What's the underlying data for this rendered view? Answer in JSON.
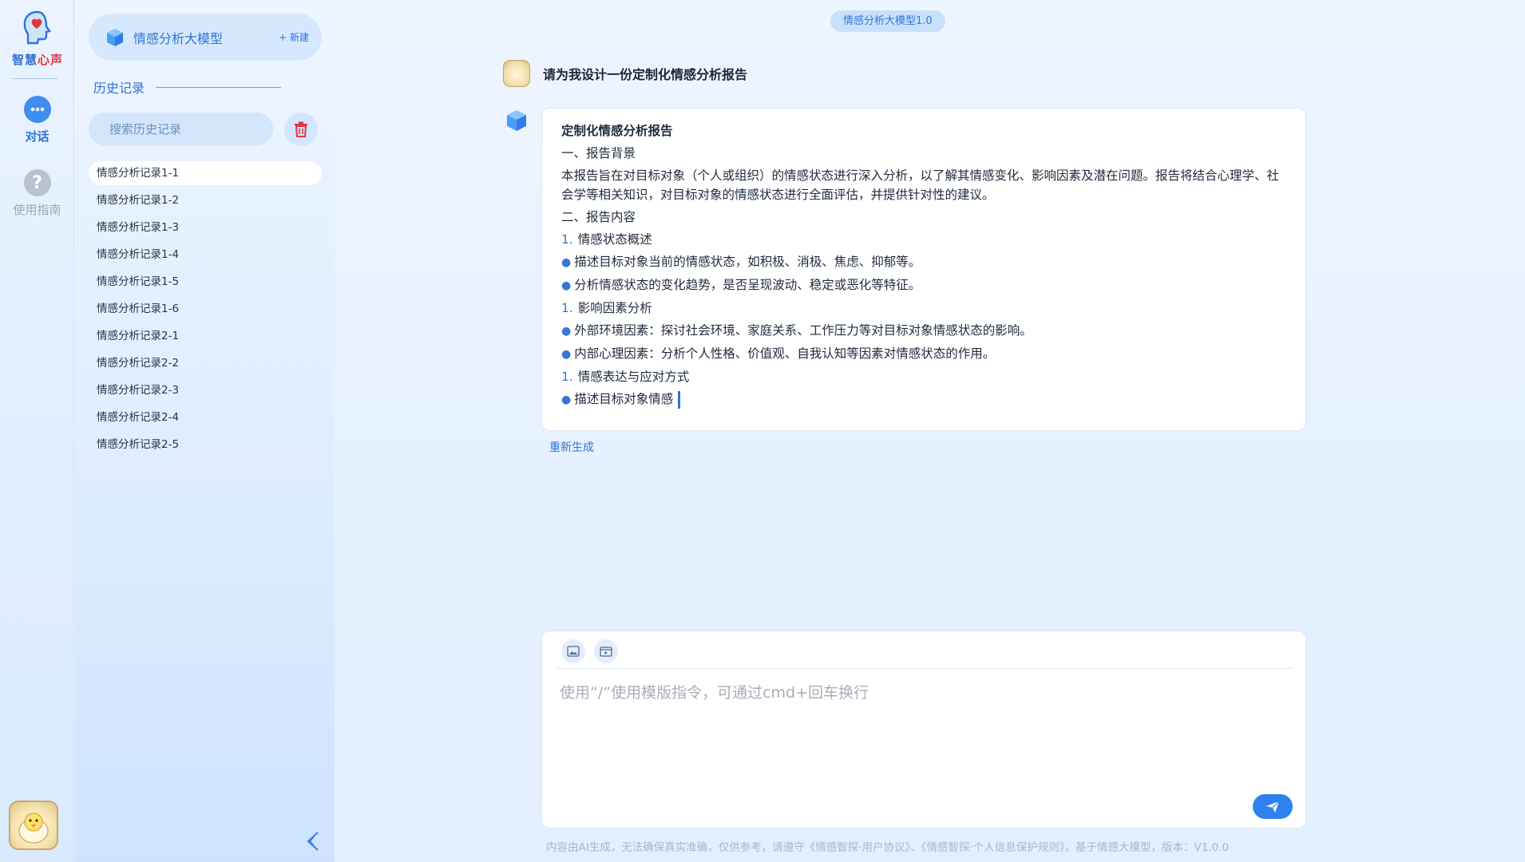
{
  "brand": {
    "name_part1": "智慧",
    "name_part2": "心声"
  },
  "rail": {
    "chat_label": "对话",
    "guide_label": "使用指南",
    "guide_glyph": "?"
  },
  "history_panel": {
    "model_name": "情感分析大模型",
    "new_label": "+ 新建",
    "title": "历史记录",
    "search_placeholder": "搜索历史记录",
    "items": [
      "情感分析记录1-1",
      "情感分析记录1-2",
      "情感分析记录1-3",
      "情感分析记录1-4",
      "情感分析记录1-5",
      "情感分析记录1-6",
      "情感分析记录2-1",
      "情感分析记录2-2",
      "情感分析记录2-3",
      "情感分析记录2-4",
      "情感分析记录2-5"
    ],
    "active_index": 0
  },
  "main": {
    "model_tag": "情感分析大模型1.0",
    "user_message": "请为我设计一份定制化情感分析报告",
    "response": {
      "title": "定制化情感分析报告",
      "section1": "一、报告背景",
      "background": "本报告旨在对目标对象（个人或组织）的情感状态进行深入分析，以了解其情感变化、影响因素及潜在问题。报告将结合心理学、社会学等相关知识，对目标对象的情感状态进行全面评估，并提供针对性的建议。",
      "section2": "二、报告内容",
      "item1_num": "1.",
      "item1": "情感状态概述",
      "item1_b1": "描述目标对象当前的情感状态，如积极、消极、焦虑、抑郁等。",
      "item1_b2": "分析情感状态的变化趋势，是否呈现波动、稳定或恶化等特征。",
      "item2_num": "1.",
      "item2": "影响因素分析",
      "item2_b1": "外部环境因素：探讨社会环境、家庭关系、工作压力等对目标对象情感状态的影响。",
      "item2_b2": "内部心理因素：分析个人性格、价值观、自我认知等因素对情感状态的作用。",
      "item3_num": "1.",
      "item3": "情感表达与应对方式",
      "item3_b1": "描述目标对象情感"
    },
    "regenerate_label": "重新生成",
    "composer_placeholder": "使用“/”使用模版指令，可通过cmd+回车换行",
    "footer_note": "内容由AI生成，无法确保真实准确，仅供参考，请遵守《情感智探·用户协议》、《情感智探·个人信息保护规则》，基于情感大模型，版本：V1.0.0"
  },
  "colors": {
    "accent": "#2f73d9",
    "brand_red": "#e2353f",
    "send": "#2f82ee"
  }
}
